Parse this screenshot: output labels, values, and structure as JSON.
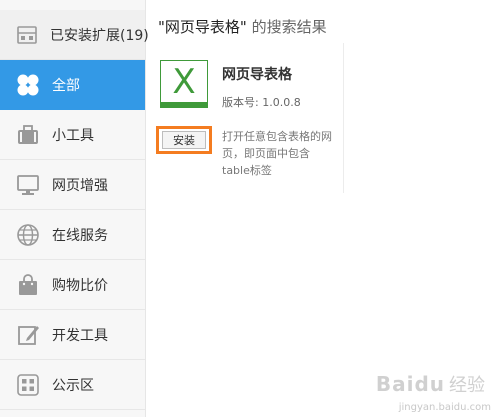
{
  "sidebar": {
    "installed": {
      "label": "已安装扩展(19)",
      "icon": "grid-box-icon"
    },
    "items": [
      {
        "label": "全部",
        "icon": "clover-icon",
        "active": true
      },
      {
        "label": "小工具",
        "icon": "briefcase-icon"
      },
      {
        "label": "网页增强",
        "icon": "monitor-icon"
      },
      {
        "label": "在线服务",
        "icon": "globe-icon"
      },
      {
        "label": "购物比价",
        "icon": "shopping-bag-icon"
      },
      {
        "label": "开发工具",
        "icon": "edit-icon"
      },
      {
        "label": "公示区",
        "icon": "dots-grid-icon"
      }
    ]
  },
  "search": {
    "keyword": "\"网页导表格\"",
    "suffix": " 的搜索结果"
  },
  "extension": {
    "name": "网页导表格",
    "version": "版本号: 1.0.0.8",
    "install_label": "安装",
    "description": "打开任意包含表格的网页，即页面中包含table标签",
    "logo_letter": "X"
  },
  "watermark": {
    "brand": "Baidu",
    "cn": "经验",
    "url": "jingyan.baidu.com"
  },
  "colors": {
    "active": "#3399e6",
    "highlight": "#f47c20",
    "excel_green": "#3f9a3a"
  }
}
